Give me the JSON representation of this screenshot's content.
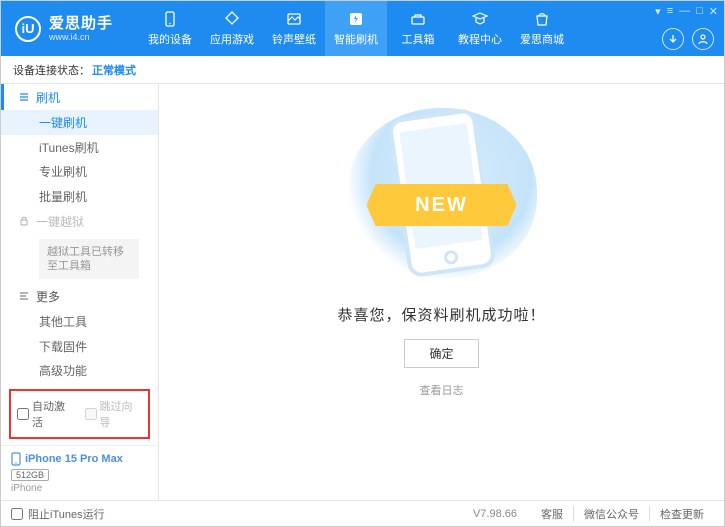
{
  "header": {
    "logo_mark": "iU",
    "app_name": "爱思助手",
    "website": "www.i4.cn",
    "nav": [
      {
        "label": "我的设备"
      },
      {
        "label": "应用游戏"
      },
      {
        "label": "铃声壁纸"
      },
      {
        "label": "智能刷机"
      },
      {
        "label": "工具箱"
      },
      {
        "label": "教程中心"
      },
      {
        "label": "爱思商城"
      }
    ],
    "active_nav": 3,
    "window_controls": [
      "▾",
      "≡",
      "—",
      "□",
      "✕"
    ]
  },
  "status": {
    "label": "设备连接状态：",
    "value": "正常模式"
  },
  "sidebar": {
    "flash_section": "刷机",
    "flash_items": [
      "一键刷机",
      "iTunes刷机",
      "专业刷机",
      "批量刷机"
    ],
    "flash_active": 0,
    "jailbreak_section": "一键越狱",
    "jailbreak_note": "越狱工具已转移至工具箱",
    "more_section": "更多",
    "more_items": [
      "其他工具",
      "下载固件",
      "高级功能"
    ],
    "checks": {
      "auto_activate": "自动激活",
      "skip_guide": "跳过向导"
    },
    "device": {
      "name": "iPhone 15 Pro Max",
      "capacity": "512GB",
      "type": "iPhone"
    }
  },
  "main": {
    "ribbon": "NEW",
    "success_text": "恭喜您，保资料刷机成功啦！",
    "ok_button": "确定",
    "log_link": "查看日志"
  },
  "footer": {
    "block_itunes": "阻止iTunes运行",
    "version": "V7.98.66",
    "links": [
      "客服",
      "微信公众号",
      "检查更新"
    ]
  }
}
